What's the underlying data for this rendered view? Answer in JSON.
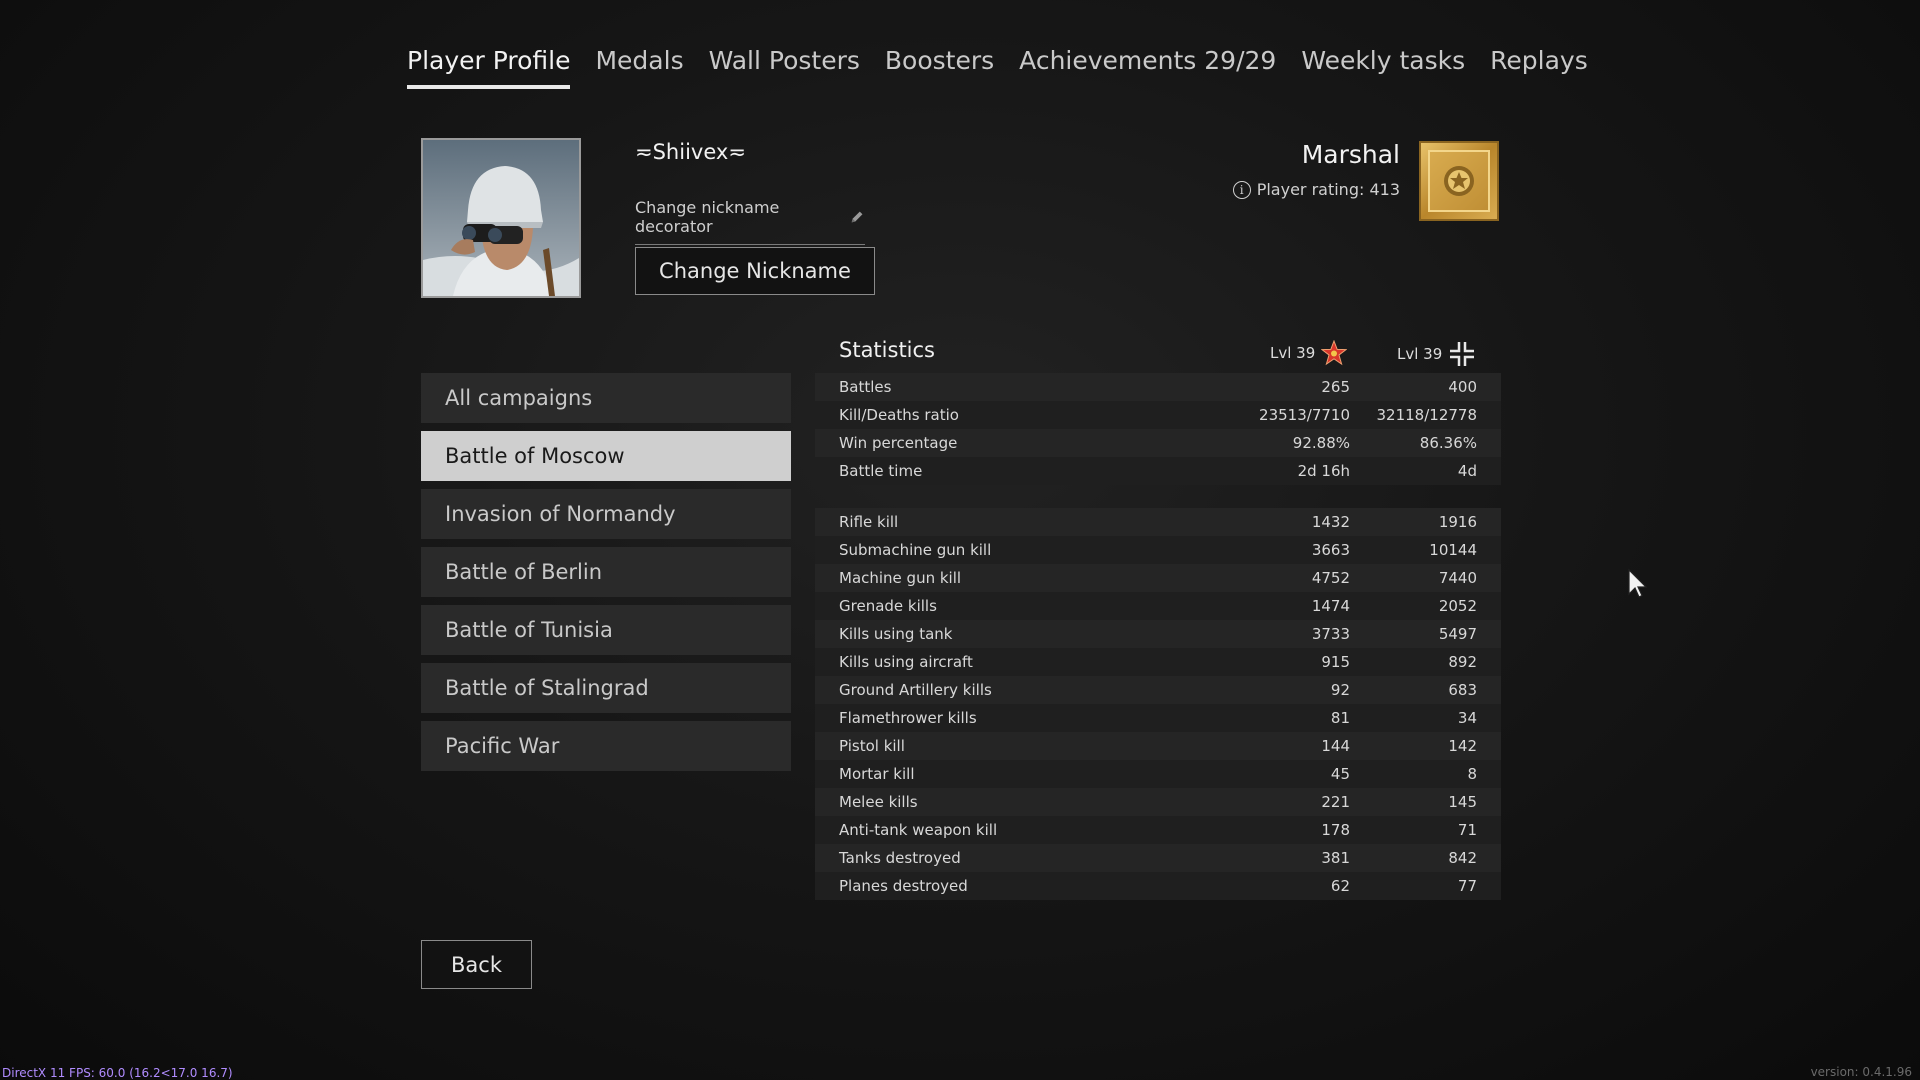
{
  "tabs": [
    {
      "label": "Player Profile",
      "active": true
    },
    {
      "label": "Medals"
    },
    {
      "label": "Wall Posters"
    },
    {
      "label": "Boosters"
    },
    {
      "label": "Achievements 29/29"
    },
    {
      "label": "Weekly tasks"
    },
    {
      "label": "Replays"
    }
  ],
  "profile": {
    "nickname": "≂Shiivex≂",
    "decorator_label": "Change nickname decorator",
    "change_nickname_label": "Change Nickname",
    "rank": "Marshal",
    "rating": "Player rating: 413"
  },
  "campaigns": [
    {
      "label": "All campaigns"
    },
    {
      "label": "Battle of Moscow",
      "selected": true
    },
    {
      "label": "Invasion of Normandy"
    },
    {
      "label": "Battle of Berlin"
    },
    {
      "label": "Battle of Tunisia"
    },
    {
      "label": "Battle of Stalingrad"
    },
    {
      "label": "Pacific War"
    }
  ],
  "statistics": {
    "title": "Statistics",
    "lvl_allies": "Lvl 39",
    "lvl_axis": "Lvl 39",
    "general": [
      {
        "label": "Battles",
        "v1": "265",
        "v2": "400"
      },
      {
        "label": "Kill/Deaths ratio",
        "v1": "23513/7710",
        "v2": "32118/12778"
      },
      {
        "label": "Win percentage",
        "v1": "92.88%",
        "v2": "86.36%"
      },
      {
        "label": "Battle time",
        "v1": "2d 16h",
        "v2": "4d"
      }
    ],
    "kills": [
      {
        "label": "Rifle kill",
        "v1": "1432",
        "v2": "1916"
      },
      {
        "label": "Submachine gun kill",
        "v1": "3663",
        "v2": "10144"
      },
      {
        "label": "Machine gun kill",
        "v1": "4752",
        "v2": "7440"
      },
      {
        "label": "Grenade kills",
        "v1": "1474",
        "v2": "2052"
      },
      {
        "label": "Kills using tank",
        "v1": "3733",
        "v2": "5497"
      },
      {
        "label": "Kills using aircraft",
        "v1": "915",
        "v2": "892"
      },
      {
        "label": "Ground Artillery kills",
        "v1": "92",
        "v2": "683"
      },
      {
        "label": "Flamethrower kills",
        "v1": "81",
        "v2": "34"
      },
      {
        "label": "Pistol kill",
        "v1": "144",
        "v2": "142"
      },
      {
        "label": "Mortar kill",
        "v1": "45",
        "v2": "8"
      },
      {
        "label": "Melee kills",
        "v1": "221",
        "v2": "145"
      },
      {
        "label": "Anti-tank weapon kill",
        "v1": "178",
        "v2": "71"
      },
      {
        "label": "Tanks destroyed",
        "v1": "381",
        "v2": "842"
      },
      {
        "label": "Planes destroyed",
        "v1": "62",
        "v2": "77"
      }
    ]
  },
  "back_label": "Back",
  "fps_text": "DirectX 11 FPS: 60.0 (16.2<17.0 16.7)",
  "version_text": "version: 0.4.1.96",
  "icons": {
    "allies": "red-star-icon",
    "axis": "balkenkreuz-icon",
    "rank": "marshal-rank-icon",
    "info": "info-icon",
    "edit": "pencil-icon"
  }
}
